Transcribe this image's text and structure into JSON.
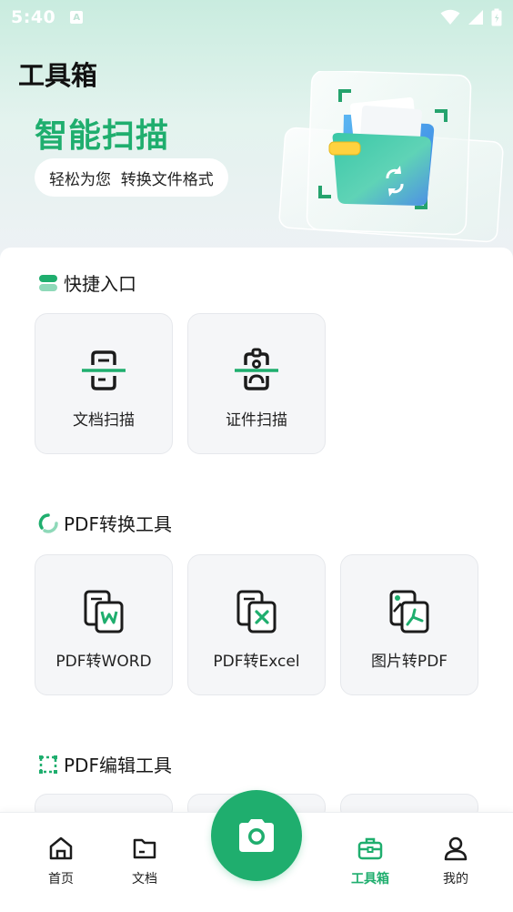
{
  "status_bar": {
    "time": "5:40",
    "notification": "A"
  },
  "header": {
    "title": "工具箱"
  },
  "banner": {
    "title": "智能扫描",
    "subtitle": "轻松为您  转换文件格式",
    "image_icon": "folder-scan-illustration"
  },
  "sections": {
    "quick": {
      "title": "快捷入口",
      "icon": "toggle-icon",
      "items": [
        {
          "label": "文档扫描",
          "icon": "document-scan-icon"
        },
        {
          "label": "证件扫描",
          "icon": "id-card-scan-icon"
        }
      ]
    },
    "pdf_convert": {
      "title": "PDF转换工具",
      "icon": "circular-arrows-icon",
      "items": [
        {
          "label": "PDF转WORD",
          "icon": "pdf-to-word-icon"
        },
        {
          "label": "PDF转Excel",
          "icon": "pdf-to-excel-icon"
        },
        {
          "label": "图片转PDF",
          "icon": "image-to-pdf-icon"
        }
      ]
    },
    "pdf_edit": {
      "title": "PDF编辑工具",
      "icon": "dashed-square-icon"
    }
  },
  "bottom_nav": {
    "items": [
      {
        "label": "首页",
        "icon": "home-icon"
      },
      {
        "label": "文档",
        "icon": "folder-icon"
      },
      {
        "label": "工具箱",
        "icon": "toolbox-icon",
        "active": true
      },
      {
        "label": "我的",
        "icon": "user-icon"
      }
    ],
    "center_button_icon": "camera-icon"
  },
  "colors": {
    "accent": "#1fae6e",
    "tile_bg": "#f5f6f8",
    "header_gradient_top": "#c9ecdf",
    "text": "#1b1b1b"
  }
}
